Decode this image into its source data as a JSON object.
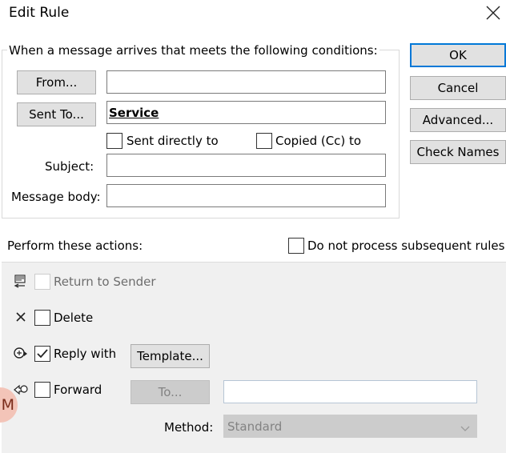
{
  "dialog": {
    "title": "Edit Rule"
  },
  "conditions": {
    "group_label": "When a message arrives that meets the following conditions:",
    "from_button": "From...",
    "from_value": "",
    "sent_to_button": "Sent To...",
    "sent_to_value": "Service",
    "sent_directly_label": "Sent directly to",
    "sent_directly_checked": false,
    "copied_label": "Copied (Cc) to",
    "copied_checked": false,
    "subject_label": "Subject:",
    "subject_value": "",
    "body_label": "Message body:",
    "body_value": ""
  },
  "side_buttons": {
    "ok": "OK",
    "cancel": "Cancel",
    "advanced": "Advanced...",
    "check_names": "Check Names"
  },
  "actions": {
    "header": "Perform these actions:",
    "do_not_process_label": "Do not process subsequent rules",
    "do_not_process_checked": false,
    "return_to_sender_label": "Return to Sender",
    "return_to_sender_checked": false,
    "delete_label": "Delete",
    "delete_checked": false,
    "reply_with_label": "Reply with",
    "reply_with_checked": true,
    "template_button": "Template...",
    "forward_label": "Forward",
    "forward_checked": false,
    "to_button": "To...",
    "forward_to_value": "",
    "method_label": "Method:",
    "method_value": "Standard"
  },
  "avatar": {
    "initial": "M"
  }
}
